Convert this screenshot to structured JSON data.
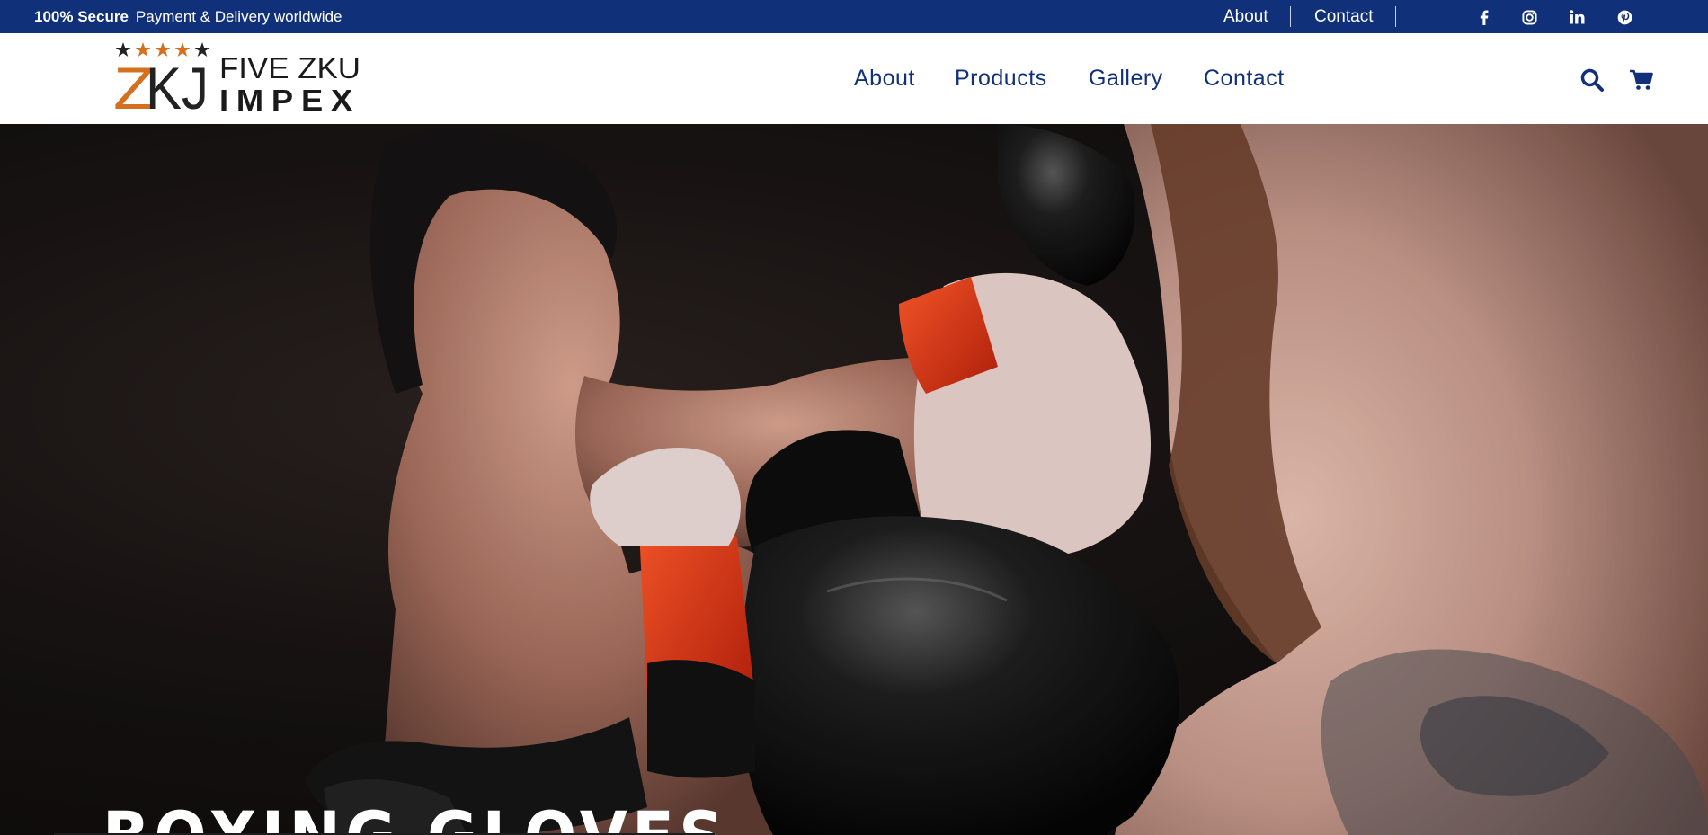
{
  "topbar": {
    "promo_bold": "100% Secure",
    "promo_text": "Payment & Delivery worldwide",
    "links": [
      "About",
      "Contact"
    ],
    "social": [
      "facebook-icon",
      "instagram-icon",
      "linkedin-icon",
      "pinterest-icon"
    ],
    "background": "#11307a"
  },
  "brand": {
    "line1": "FIVE ZKU",
    "line2": "IMPEX",
    "monogram_left": "Z",
    "monogram_right": "KJ",
    "star_count": 5,
    "accent": "#d4701e"
  },
  "nav": {
    "items": [
      "About",
      "Products",
      "Gallery",
      "Contact"
    ],
    "color": "#11307a"
  },
  "header_icons": [
    "search-icon",
    "cart-icon"
  ],
  "hero": {
    "title": "BOXING GLOVES",
    "image": "boxing-photo"
  }
}
